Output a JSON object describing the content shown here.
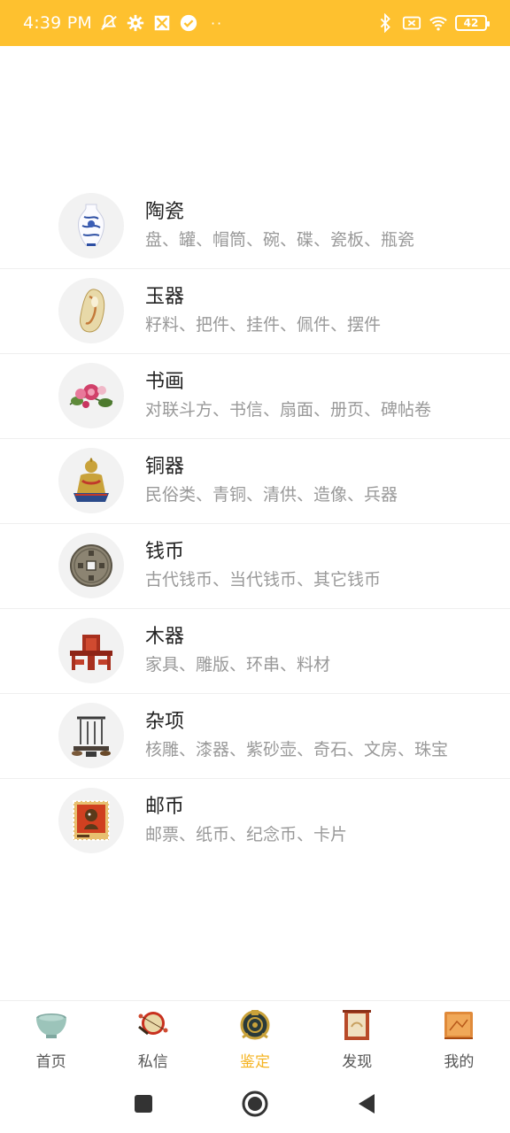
{
  "status": {
    "time": "4:39 PM",
    "battery": "42",
    "dots": "··"
  },
  "categories": [
    {
      "title": "陶瓷",
      "subtitle": "盘、罐、帽筒、碗、碟、瓷板、瓶瓷",
      "icon": "porcelain-vase-icon"
    },
    {
      "title": "玉器",
      "subtitle": "籽料、把件、挂件、佩件、摆件",
      "icon": "jade-icon"
    },
    {
      "title": "书画",
      "subtitle": "对联斗方、书信、扇面、册页、碑帖卷",
      "icon": "painting-icon"
    },
    {
      "title": "铜器",
      "subtitle": "民俗类、青铜、清供、造像、兵器",
      "icon": "bronze-buddha-icon"
    },
    {
      "title": "钱币",
      "subtitle": "古代钱币、当代钱币、其它钱币",
      "icon": "coin-icon"
    },
    {
      "title": "木器",
      "subtitle": "家具、雕版、环串、料材",
      "icon": "furniture-icon"
    },
    {
      "title": "杂项",
      "subtitle": "核雕、漆器、紫砂壶、奇石、文房、珠宝",
      "icon": "miscellaneous-icon"
    },
    {
      "title": "邮币",
      "subtitle": "邮票、纸币、纪念币、卡片",
      "icon": "stamp-icon"
    }
  ],
  "bottom_nav": [
    {
      "label": "首页",
      "icon": "bowl-icon",
      "active": false
    },
    {
      "label": "私信",
      "icon": "drum-icon",
      "active": false
    },
    {
      "label": "鉴定",
      "icon": "appraise-icon",
      "active": true
    },
    {
      "label": "发现",
      "icon": "frame-icon",
      "active": false
    },
    {
      "label": "我的",
      "icon": "box-icon",
      "active": false
    }
  ],
  "colors": {
    "status_bar": "#fec12f",
    "active_tab": "#f5b423",
    "subtitle": "#999999"
  }
}
